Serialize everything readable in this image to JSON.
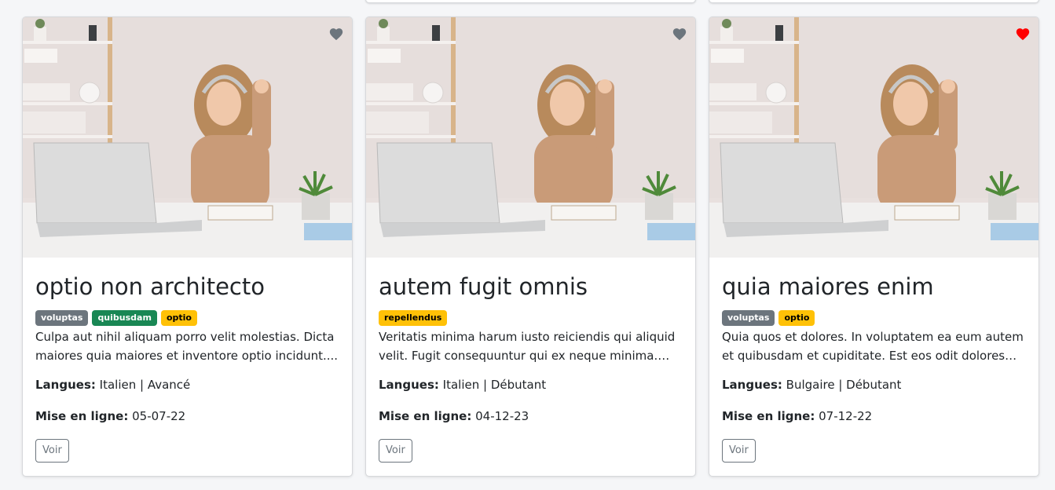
{
  "colors": {
    "favorite_active": "#ff0000",
    "favorite_inactive": "#6c757d",
    "badge_grey": "#6c757d",
    "badge_green": "#198754",
    "badge_yellow": "#ffc107"
  },
  "cards": [
    {
      "title": "optio non architecto",
      "favorited": false,
      "tags": [
        {
          "label": "voluptas",
          "variant": "grey"
        },
        {
          "label": "quibusdam",
          "variant": "green"
        },
        {
          "label": "optio",
          "variant": "yellow"
        }
      ],
      "description": "Culpa aut nihil aliquam porro velit molestias. Dicta maiores quia maiores et inventore optio incidunt....",
      "langues_label": "Langues:",
      "langues_value": "Italien | Avancé",
      "date_label": "Mise en ligne:",
      "date_value": "05-07-22",
      "button_label": "Voir"
    },
    {
      "title": "autem fugit omnis",
      "favorited": false,
      "tags": [
        {
          "label": "repellendus",
          "variant": "yellow"
        }
      ],
      "description": "Veritatis minima harum iusto reiciendis qui aliquid velit. Fugit consequuntur qui ex neque minima. Quis...",
      "langues_label": "Langues:",
      "langues_value": "Italien | Débutant",
      "date_label": "Mise en ligne:",
      "date_value": "04-12-23",
      "button_label": "Voir"
    },
    {
      "title": "quia maiores enim",
      "favorited": true,
      "tags": [
        {
          "label": "voluptas",
          "variant": "grey"
        },
        {
          "label": "optio",
          "variant": "yellow"
        }
      ],
      "description": "Quia quos et dolores. In voluptatem ea eum autem et quibusdam et cupiditate. Est eos odit dolores iste...",
      "langues_label": "Langues:",
      "langues_value": "Bulgaire | Débutant",
      "date_label": "Mise en ligne:",
      "date_value": "07-12-22",
      "button_label": "Voir"
    }
  ]
}
